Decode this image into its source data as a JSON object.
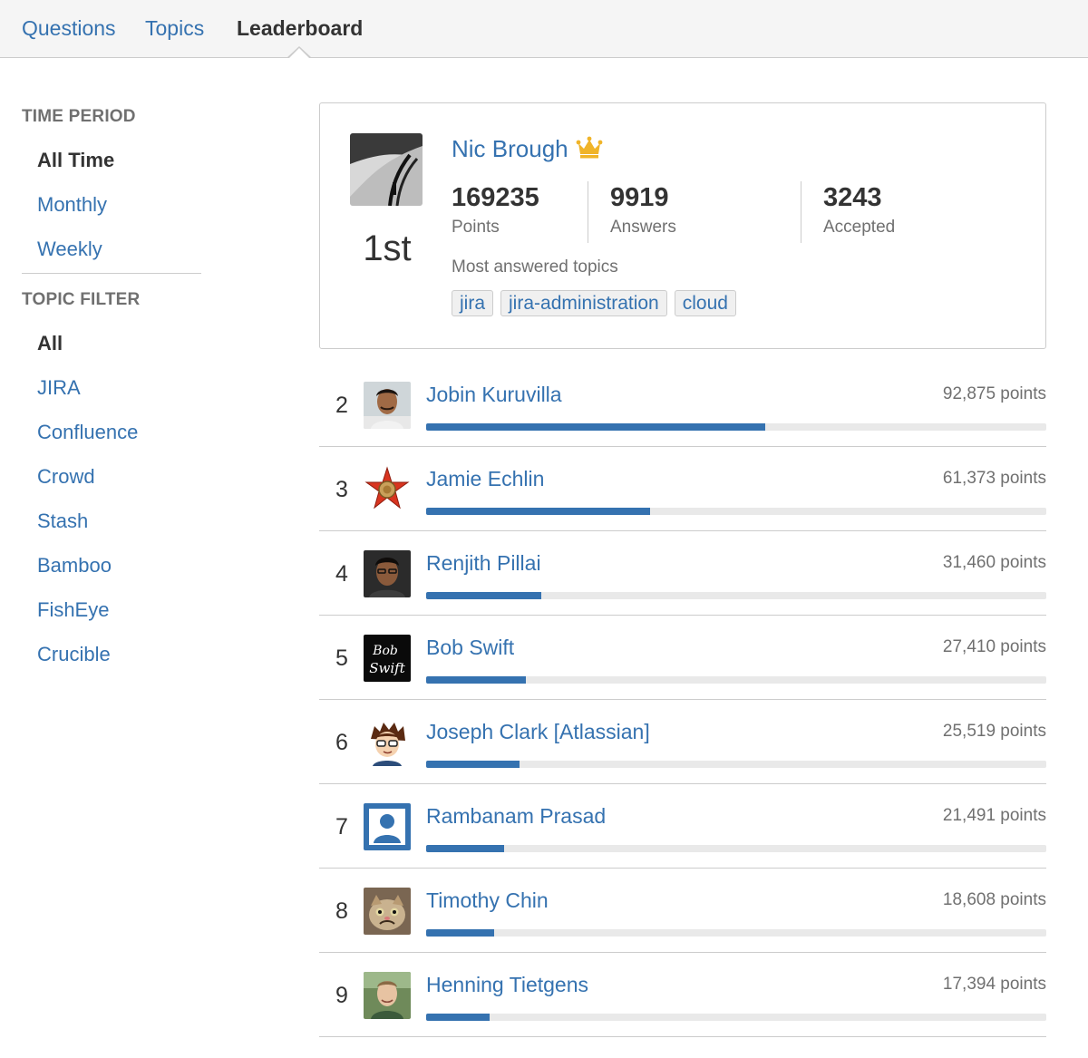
{
  "nav": {
    "tabs": [
      {
        "label": "Questions",
        "active": false
      },
      {
        "label": "Topics",
        "active": false
      },
      {
        "label": "Leaderboard",
        "active": true
      }
    ]
  },
  "sidebar": {
    "time_period": {
      "heading": "TIME PERIOD",
      "items": [
        {
          "label": "All Time",
          "selected": true
        },
        {
          "label": "Monthly",
          "selected": false
        },
        {
          "label": "Weekly",
          "selected": false
        }
      ]
    },
    "topic_filter": {
      "heading": "TOPIC FILTER",
      "items": [
        {
          "label": "All",
          "selected": true
        },
        {
          "label": "JIRA",
          "selected": false
        },
        {
          "label": "Confluence",
          "selected": false
        },
        {
          "label": "Crowd",
          "selected": false
        },
        {
          "label": "Stash",
          "selected": false
        },
        {
          "label": "Bamboo",
          "selected": false
        },
        {
          "label": "FishEye",
          "selected": false
        },
        {
          "label": "Crucible",
          "selected": false
        }
      ]
    }
  },
  "leader": {
    "name": "Nic Brough",
    "rank": "1st",
    "icon": "crown-icon",
    "stats": [
      {
        "value": "169235",
        "label": "Points"
      },
      {
        "value": "9919",
        "label": "Answers"
      },
      {
        "value": "3243",
        "label": "Accepted"
      }
    ],
    "topics_label": "Most answered topics",
    "topics": [
      "jira",
      "jira-administration",
      "cloud"
    ]
  },
  "colors": {
    "accent": "#3572b0",
    "crown": "#f0b429",
    "bar_track": "#e9e9e9"
  },
  "rankings": [
    {
      "rank": "2",
      "name": "Jobin Kuruvilla",
      "points_text": "92,875 points",
      "points": 92875
    },
    {
      "rank": "3",
      "name": "Jamie Echlin",
      "points_text": "61,373 points",
      "points": 61373
    },
    {
      "rank": "4",
      "name": "Renjith Pillai",
      "points_text": "31,460 points",
      "points": 31460
    },
    {
      "rank": "5",
      "name": "Bob Swift",
      "points_text": "27,410 points",
      "points": 27410,
      "avatar_text": [
        "Bob",
        "Swift"
      ]
    },
    {
      "rank": "6",
      "name": "Joseph Clark [Atlassian]",
      "points_text": "25,519 points",
      "points": 25519
    },
    {
      "rank": "7",
      "name": "Rambanam Prasad",
      "points_text": "21,491 points",
      "points": 21491
    },
    {
      "rank": "8",
      "name": "Timothy Chin",
      "points_text": "18,608 points",
      "points": 18608
    },
    {
      "rank": "9",
      "name": "Henning Tietgens",
      "points_text": "17,394 points",
      "points": 17394
    }
  ],
  "bar_scale_max": 170000
}
